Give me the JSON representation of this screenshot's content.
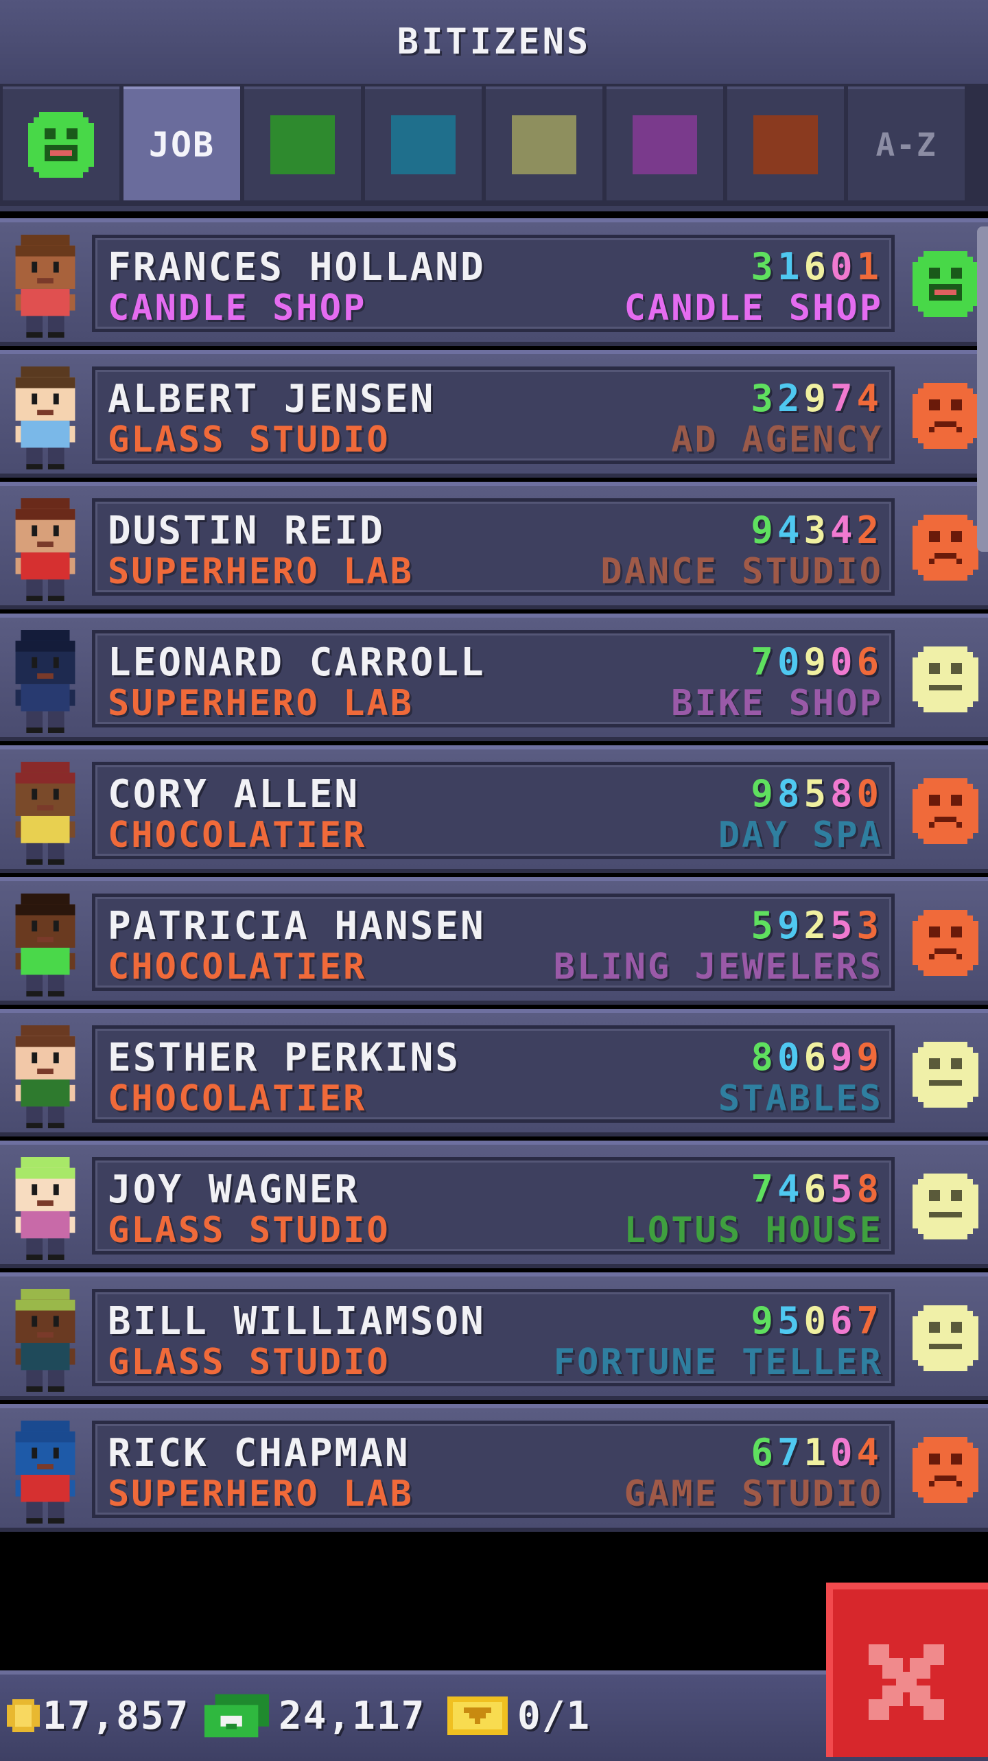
{
  "header": {
    "title": "BITIZENS"
  },
  "tabs": [
    {
      "type": "mood",
      "color": "#2fb82f"
    },
    {
      "type": "label",
      "label": "JOB",
      "active": true
    },
    {
      "type": "swatch",
      "color": "#2e8a2e"
    },
    {
      "type": "swatch",
      "color": "#1f6f8c"
    },
    {
      "type": "swatch",
      "color": "#8e8f5e"
    },
    {
      "type": "swatch",
      "color": "#7a3a8c"
    },
    {
      "type": "swatch",
      "color": "#8a3a1f"
    },
    {
      "type": "label",
      "label": "A-Z",
      "muted": true
    }
  ],
  "bitizens": [
    {
      "name": "FRANCES HOLLAND",
      "home": "CANDLE SHOP",
      "home_color": "#e46cf0",
      "digits": [
        "3",
        "1",
        "6",
        "0",
        "1"
      ],
      "work": "CANDLE SHOP",
      "work_color": "#e46cf0",
      "mood": "happy",
      "skin": "#a8623c",
      "hair": "#6a3a1c",
      "shirt": "#e05050"
    },
    {
      "name": "ALBERT JENSEN",
      "home": "GLASS STUDIO",
      "home_color": "#f06a3a",
      "digits": [
        "3",
        "2",
        "9",
        "7",
        "4"
      ],
      "work": "AD AGENCY",
      "work_color": "#9a5a4a",
      "mood": "sad",
      "skin": "#f5d3b0",
      "hair": "#5a3a20",
      "shirt": "#7ab8e8"
    },
    {
      "name": "DUSTIN REID",
      "home": "SUPERHERO LAB",
      "home_color": "#f06a3a",
      "digits": [
        "9",
        "4",
        "3",
        "4",
        "2"
      ],
      "work": "DANCE STUDIO",
      "work_color": "#a05a48",
      "mood": "sad",
      "skin": "#d8a07a",
      "hair": "#6a2a1a",
      "shirt": "#d63030"
    },
    {
      "name": "LEONARD CARROLL",
      "home": "SUPERHERO LAB",
      "home_color": "#f06a3a",
      "digits": [
        "7",
        "0",
        "9",
        "0",
        "6"
      ],
      "work": "BIKE SHOP",
      "work_color": "#9a5aa8",
      "mood": "neutral",
      "skin": "#1e2a50",
      "hair": "#141c3a",
      "shirt": "#283a70"
    },
    {
      "name": "CORY ALLEN",
      "home": "CHOCOLATIER",
      "home_color": "#f06a3a",
      "digits": [
        "9",
        "8",
        "5",
        "8",
        "0"
      ],
      "work": "DAY SPA",
      "work_color": "#2f7fa0",
      "mood": "sad",
      "skin": "#7a4a2a",
      "hair": "#8a2a2a",
      "shirt": "#e8d050"
    },
    {
      "name": "PATRICIA HANSEN",
      "home": "CHOCOLATIER",
      "home_color": "#f06a3a",
      "digits": [
        "5",
        "9",
        "2",
        "5",
        "3"
      ],
      "work": "BLING JEWELERS",
      "work_color": "#9a5aa8",
      "mood": "sad",
      "skin": "#6a3a20",
      "hair": "#2a160c",
      "shirt": "#4ad84a"
    },
    {
      "name": "ESTHER PERKINS",
      "home": "CHOCOLATIER",
      "home_color": "#f06a3a",
      "digits": [
        "8",
        "0",
        "6",
        "9",
        "9"
      ],
      "work": "STABLES",
      "work_color": "#2f7fa0",
      "mood": "neutral",
      "skin": "#f2c8a8",
      "hair": "#6a3a22",
      "shirt": "#2e7a2e"
    },
    {
      "name": "JOY WAGNER",
      "home": "GLASS STUDIO",
      "home_color": "#f06a3a",
      "digits": [
        "7",
        "4",
        "6",
        "5",
        "8"
      ],
      "work": "LOTUS HOUSE",
      "work_color": "#3fa03f",
      "mood": "neutral",
      "skin": "#f7dcc0",
      "hair": "#a8e868",
      "shirt": "#c86aa8"
    },
    {
      "name": "BILL WILLIAMSON",
      "home": "GLASS STUDIO",
      "home_color": "#f06a3a",
      "digits": [
        "9",
        "5",
        "0",
        "6",
        "7"
      ],
      "work": "FORTUNE TELLER",
      "work_color": "#2f7fa0",
      "mood": "neutral",
      "skin": "#6a3a22",
      "hair": "#9ab84a",
      "shirt": "#1f4a5a"
    },
    {
      "name": "RICK CHAPMAN",
      "home": "SUPERHERO LAB",
      "home_color": "#f06a3a",
      "digits": [
        "6",
        "7",
        "1",
        "0",
        "4"
      ],
      "work": "GAME STUDIO",
      "work_color": "#a05a48",
      "mood": "sad",
      "skin": "#1e5aa8",
      "hair": "#1a4a90",
      "shirt": "#d63030"
    }
  ],
  "digit_colors": [
    "#5fe05f",
    "#4fc8f0",
    "#f0f0a0",
    "#f07ad0",
    "#f06a3a"
  ],
  "mood_colors": {
    "happy": "#48d848",
    "sad": "#f06a3a",
    "neutral": "#f0f0a8"
  },
  "footer": {
    "coins": "17,857",
    "bux": "24,117",
    "tickets": "0/1"
  }
}
